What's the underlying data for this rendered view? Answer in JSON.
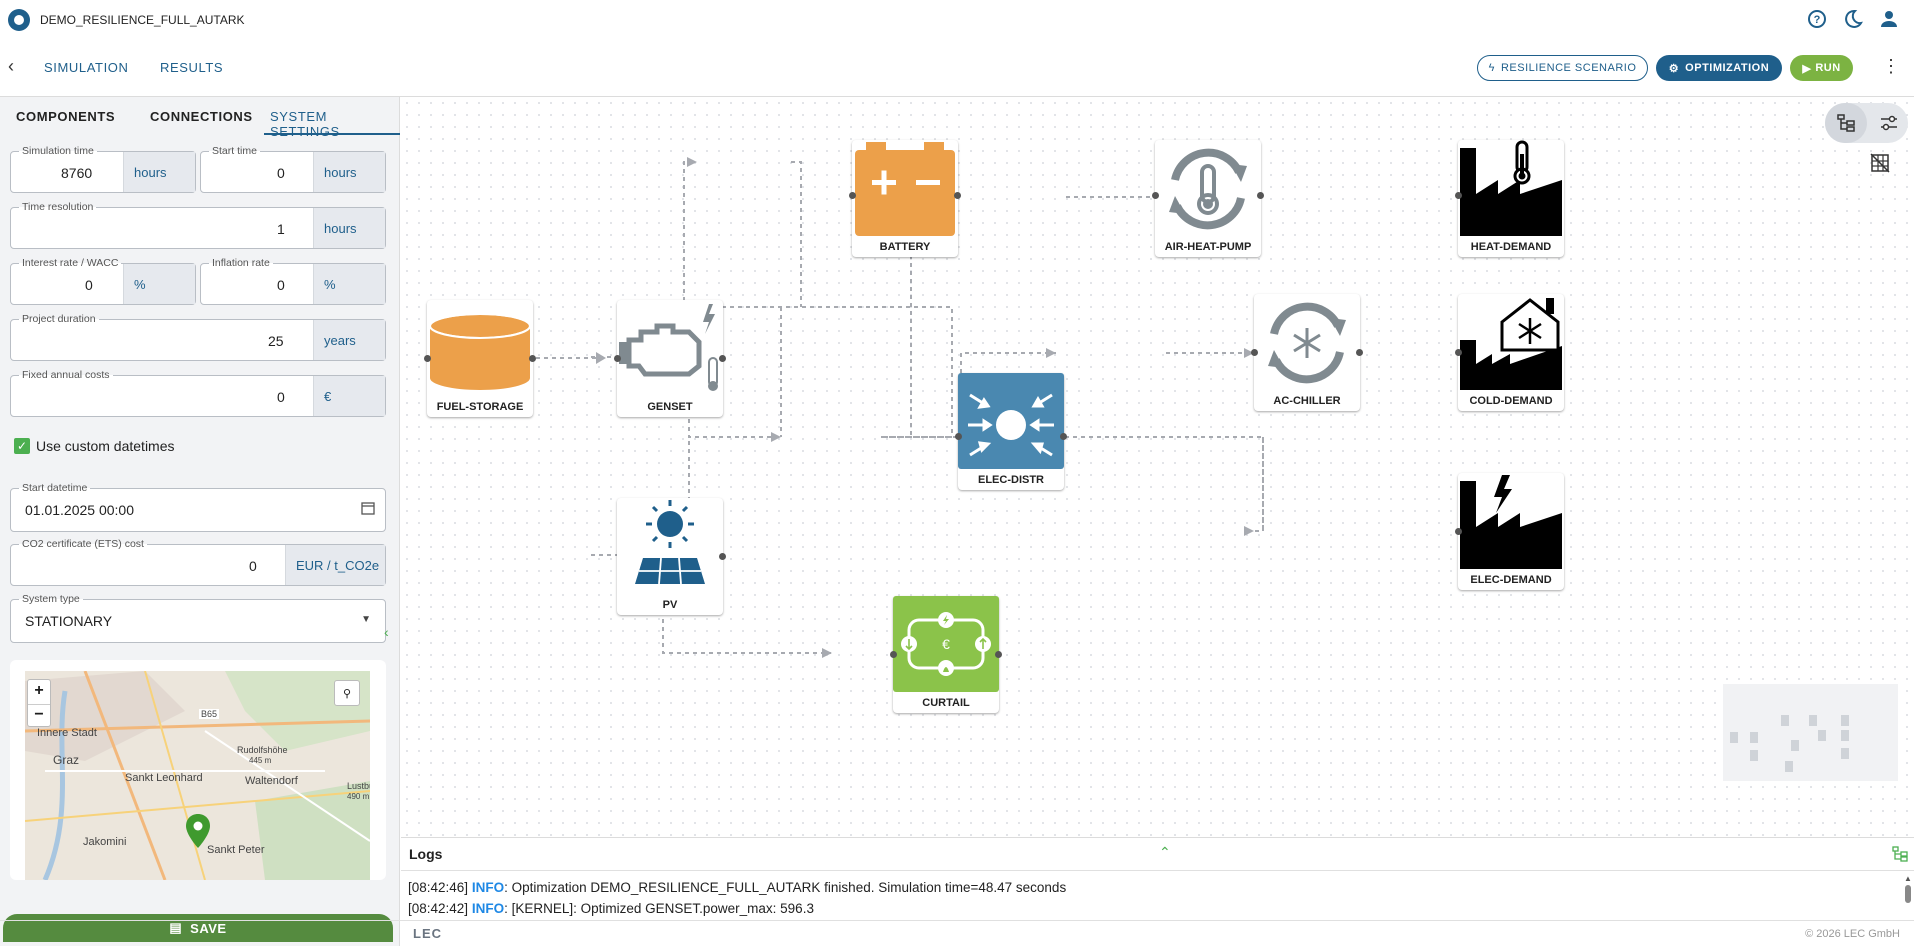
{
  "app": {
    "title": "DEMO_RESILIENCE_FULL_AUTARK"
  },
  "nav": {
    "tabs": [
      "SIMULATION",
      "RESULTS"
    ],
    "resilience_label": "RESILIENCE SCENARIO",
    "optimization_label": "OPTIMIZATION",
    "run_label": "RUN"
  },
  "sidebar": {
    "tabs": [
      "COMPONENTS",
      "CONNECTIONS",
      "SYSTEM SETTINGS"
    ],
    "active_tab": "SYSTEM SETTINGS",
    "fields": {
      "simulation_time": {
        "label": "Simulation time",
        "value": "8760",
        "unit": "hours"
      },
      "start_time": {
        "label": "Start time",
        "value": "0",
        "unit": "hours"
      },
      "time_resolution": {
        "label": "Time resolution",
        "value": "1",
        "unit": "hours"
      },
      "interest_rate": {
        "label": "Interest rate / WACC",
        "value": "0",
        "unit": "%"
      },
      "inflation_rate": {
        "label": "Inflation rate",
        "value": "0",
        "unit": "%"
      },
      "project_duration": {
        "label": "Project duration",
        "value": "25",
        "unit": "years"
      },
      "fixed_annual_costs": {
        "label": "Fixed annual costs",
        "value": "0",
        "unit": "€"
      },
      "start_datetime": {
        "label": "Start datetime",
        "value": "01.01.2025 00:00"
      },
      "co2_cost": {
        "label": "CO2 certificate (ETS) cost",
        "value": "0",
        "unit": "EUR / t_CO2e"
      },
      "system_type": {
        "label": "System type",
        "value": "STATIONARY"
      }
    },
    "custom_datetimes_label": "Use custom datetimes",
    "custom_datetimes_checked": true,
    "map": {
      "labels": [
        "Innere Stadt",
        "Graz",
        "Sankt Leonhard",
        "Rudolfshöhe",
        "445 m",
        "Waltendorf",
        "Lustbühel",
        "490 m",
        "Jakomini",
        "Sankt Peter",
        "B65"
      ],
      "zoom_in": "+",
      "zoom_out": "−"
    },
    "save_label": "SAVE"
  },
  "nodes": {
    "battery": "BATTERY",
    "air_heat_pump": "AIR-HEAT-PUMP",
    "heat_demand": "HEAT-DEMAND",
    "fuel_storage": "FUEL-STORAGE",
    "genset": "GENSET",
    "elec_distr": "ELEC-DISTR",
    "ac_chiller": "AC-CHILLER",
    "cold_demand": "COLD-DEMAND",
    "pv": "PV",
    "elec_demand": "ELEC-DEMAND",
    "curtail": "CURTAIL"
  },
  "colors": {
    "primary": "#1f5f8b",
    "run_green": "#7cb342",
    "battery_orange": "#eca04a",
    "distr_blue": "#4a88b0",
    "curtail_green": "#8bc34a",
    "pv_blue": "#1f5f8b",
    "icon_grey": "#808a90"
  },
  "logs": {
    "title": "Logs",
    "lines": [
      {
        "time": "[08:42:46]",
        "level": "INFO",
        "message": ": Optimization DEMO_RESILIENCE_FULL_AUTARK finished. Simulation time=48.47 seconds"
      },
      {
        "time": "[08:42:42]",
        "level": "INFO",
        "message": ": [KERNEL]: Optimized GENSET.power_max: 596.3"
      }
    ]
  },
  "footer": {
    "copyright": "© 2026 LEC GmbH",
    "logo_text": "LEC"
  }
}
